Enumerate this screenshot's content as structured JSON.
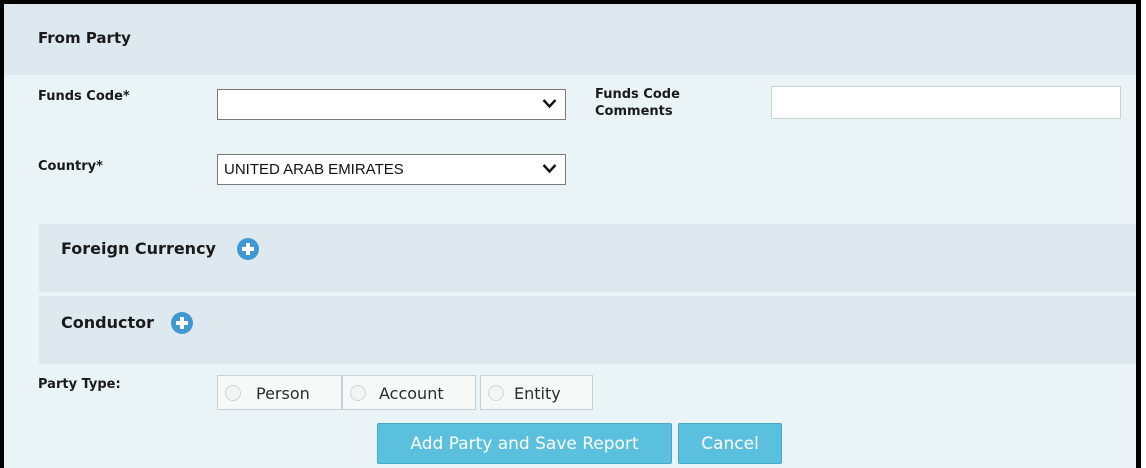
{
  "header": {
    "title": "From Party"
  },
  "fields": {
    "funds_code_label": "Funds Code*",
    "funds_code_value": "",
    "funds_code_comments_label_1": "Funds Code",
    "funds_code_comments_label_2": "Comments",
    "funds_code_comments_value": "",
    "country_label": "Country*",
    "country_value": "UNITED ARAB EMIRATES"
  },
  "sections": {
    "foreign_currency": "Foreign Currency",
    "conductor": "Conductor"
  },
  "party_type": {
    "label": "Party Type:",
    "options": [
      "Person",
      "Account",
      "Entity"
    ]
  },
  "buttons": {
    "add_save": "Add Party and Save Report",
    "cancel": "Cancel"
  },
  "colors": {
    "button": "#5bc0de",
    "plus_icon": "#3f97d3",
    "panel": "#eaf3f5",
    "section": "#dde9ee"
  }
}
